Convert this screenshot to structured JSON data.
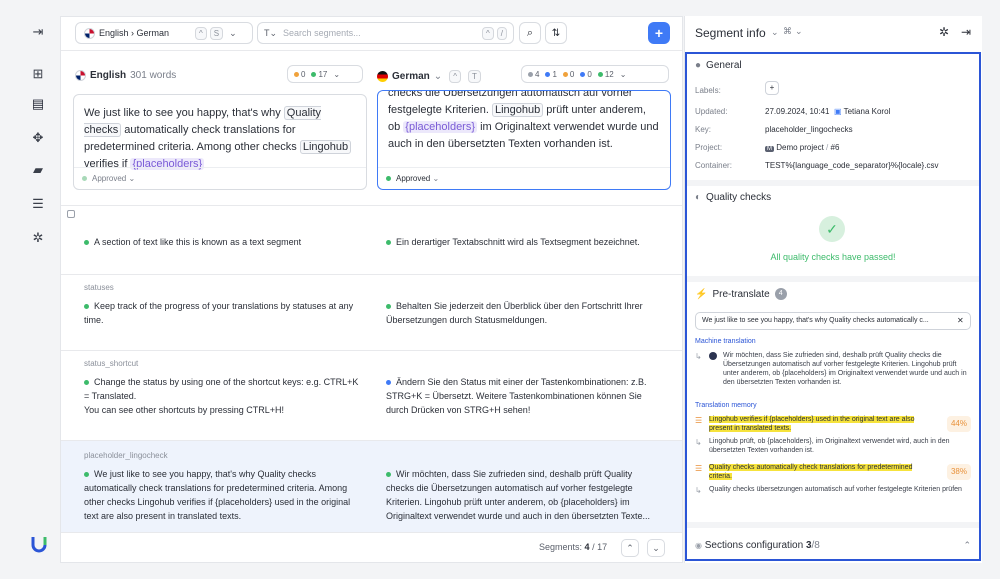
{
  "rail": {
    "icons": [
      "collapse-icon",
      "grid-icon",
      "layout-icon",
      "components-icon",
      "comment-icon",
      "storage-icon",
      "settings-icon"
    ]
  },
  "toolbar": {
    "lang_pair": "English › German",
    "lang_kbd1": "^",
    "lang_kbd2": "S",
    "search_type": "T",
    "search_placeholder": "Search segments...",
    "search_kbd1": "^",
    "search_kbd2": "/",
    "add_label": "+"
  },
  "source": {
    "lang": "English",
    "words": "301 words",
    "counters": [
      {
        "color": "#f0a23c",
        "value": "0"
      },
      {
        "color": "#3dbb6b",
        "value": "17"
      }
    ],
    "text_parts": [
      {
        "t": "We just like to see you happy, that's why ",
        "c": ""
      },
      {
        "t": "Quality checks",
        "c": "tag"
      },
      {
        "t": " automatically check translations for predetermined criteria. Among other checks ",
        "c": ""
      },
      {
        "t": "Lingohub",
        "c": "tag"
      },
      {
        "t": " verifies if ",
        "c": ""
      },
      {
        "t": "{placeholders}",
        "c": "ph"
      }
    ],
    "status": "Approved"
  },
  "target": {
    "lang": "German",
    "kbd1": "^",
    "kbd2": "T",
    "counters": [
      {
        "color": "#9aa0aa",
        "value": "4"
      },
      {
        "color": "#3f7af6",
        "value": "1"
      },
      {
        "color": "#f0a23c",
        "value": "0"
      },
      {
        "color": "#3f7af6",
        "value": "0"
      },
      {
        "color": "#3dbb6b",
        "value": "12"
      }
    ],
    "text_parts": [
      {
        "t": "checks  die Übersetzungen automatisch auf vorher festgelegte Kriterien. ",
        "c": ""
      },
      {
        "t": "Lingohub",
        "c": "tag"
      },
      {
        "t": " prüft unter anderem, ob ",
        "c": ""
      },
      {
        "t": "{placeholders}",
        "c": "ph"
      },
      {
        "t": " im Originaltext verwendet wurde und auch in den übersetzten Texten vorhanden ist.",
        "c": ""
      }
    ],
    "status": "Approved"
  },
  "segments": [
    {
      "key": "",
      "src": "A section of text like this is known as a text segment",
      "tgt": "Ein derartiger Textabschnitt wird als Textsegment bezeichnet."
    },
    {
      "key": "statuses",
      "src": "Keep track of the progress of your translations by statuses at any time.",
      "tgt": "Behalten Sie jederzeit den Überblick über den Fortschritt Ihrer Übersetzungen durch Statusmeldungen."
    },
    {
      "key": "status_shortcut",
      "src": "Change the status by using one of the shortcut keys: e.g. CTRL+K = Translated.",
      "src2": "You can see other shortcuts by pressing CTRL+H!",
      "tgt": "Ändern Sie den Status mit einer der Tastenkombinationen: z.B. STRG+K = Übersetzt. Weitere Tastenkombinationen können Sie durch Drücken von STRG+H sehen!"
    },
    {
      "key": "placeholder_lingocheck",
      "src": "We just like to see you happy, that's why Quality checks automatically check translations for predetermined criteria. Among other checks Lingohub verifies if {placeholders} used in the original text are also present in translated texts.",
      "tgt": "Wir möchten, dass Sie zufrieden sind, deshalb prüft Quality checks die Übersetzungen automatisch auf vorher festgelegte Kriterien. Lingohub prüft unter anderem, ob {placeholders} im Originaltext verwendet wurde und auch in den übersetzten Texte..."
    }
  ],
  "footer": {
    "label": "Segments:",
    "current": "4",
    "sep": "/",
    "total": "17"
  },
  "panel": {
    "title": "Segment info",
    "shortcut": "⌘",
    "general": {
      "title": "General",
      "labels_key": "Labels:",
      "updated_key": "Updated:",
      "updated_val": "27.09.2024, 10:41",
      "user": "Tetiana Korol",
      "key_key": "Key:",
      "key_val": "placeholder_lingochecks",
      "project_key": "Project:",
      "project_val": "Demo project",
      "project_sep": "/",
      "project_num": "#6",
      "container_key": "Container:",
      "container_val": "TEST%{language_code_separator}%{locale}.csv"
    },
    "quality": {
      "title": "Quality checks",
      "passed": "All quality checks have passed!"
    },
    "pretranslate": {
      "title": "Pre-translate",
      "count": "4",
      "query": "We just like to see you happy, that's why Quality checks automatically c...",
      "mt_title": "Machine translation",
      "mt_text": "Wir möchten, dass Sie zufrieden sind, deshalb prüft Quality checks die Übersetzungen automatisch auf vorher festgelegte Kriterien. Lingohub prüft unter anderem, ob {placeholders} im Originaltext verwendet wurde und auch in den übersetzten Texten vorhanden ist.",
      "tm_title": "Translation memory",
      "tm1_src": "Lingohub verifies if {placeholders} used in the original text are also present in translated texts.",
      "tm1_pct": "44%",
      "tm1_tgt": "Lingohub prüft, ob {placeholders}, im Originaltext verwendet wird, auch in den übersetzten Texten vorhanden ist.",
      "tm2_src": "Quality checks automatically check translations for predetermined criteria.",
      "tm2_pct": "38%",
      "tm2_tgt": "Quality checks übersetzungen automatisch auf vorher festgelegte Kriterien prüfen"
    },
    "sections": {
      "title": "Sections configuration",
      "count": "3",
      "total": "/8"
    }
  }
}
